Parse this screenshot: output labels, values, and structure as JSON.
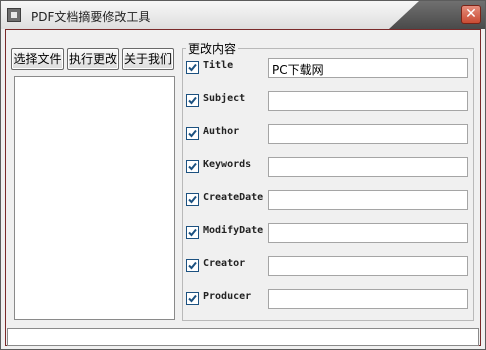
{
  "window": {
    "title": "PDF文档摘要修改工具",
    "close_label": "✕"
  },
  "toolbar": {
    "select_file": "选择文件",
    "execute_change": "执行更改",
    "about_us": "关于我们"
  },
  "group": {
    "title": "更改内容",
    "fields": [
      {
        "label": "Title",
        "value": "PC下载网",
        "checked": true
      },
      {
        "label": "Subject",
        "value": "",
        "checked": true
      },
      {
        "label": "Author",
        "value": "",
        "checked": true
      },
      {
        "label": "Keywords",
        "value": "",
        "checked": true
      },
      {
        "label": "CreateDate",
        "value": "",
        "checked": true
      },
      {
        "label": "ModifyDate",
        "value": "",
        "checked": true
      },
      {
        "label": "Creator",
        "value": "",
        "checked": true
      },
      {
        "label": "Producer",
        "value": "",
        "checked": true
      }
    ]
  },
  "colors": {
    "checkmark": "#1c5180",
    "close_button": "#c94b33"
  }
}
